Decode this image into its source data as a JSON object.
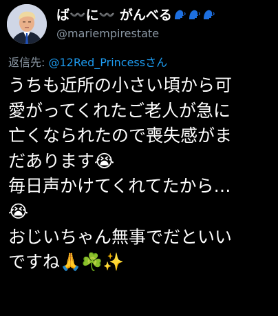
{
  "tweet": {
    "author": {
      "name_text": "ば〰️に〰️ がんべる",
      "name_emoji": "🗣️🗣️🗣️",
      "handle": "@mariempirestate"
    },
    "reply": {
      "prefix": "返信先: ",
      "mention": "@12Red_Princess",
      "suffix": "さん"
    },
    "lines": [
      "うちも近所の小さい頃から可",
      "愛がってくれたご老人が急に",
      "亡くなられたので喪失感がま",
      "だあります😭",
      "毎日声かけてくれてたから…",
      "😭",
      "おじいちゃん無事でだといい",
      "ですね🙏☘️✨"
    ]
  },
  "colors": {
    "background": "#000000",
    "text": "#ffffff",
    "secondary": "#8b98a5",
    "link": "#1d9bf0",
    "speak_icon": "#1d6fe0"
  }
}
